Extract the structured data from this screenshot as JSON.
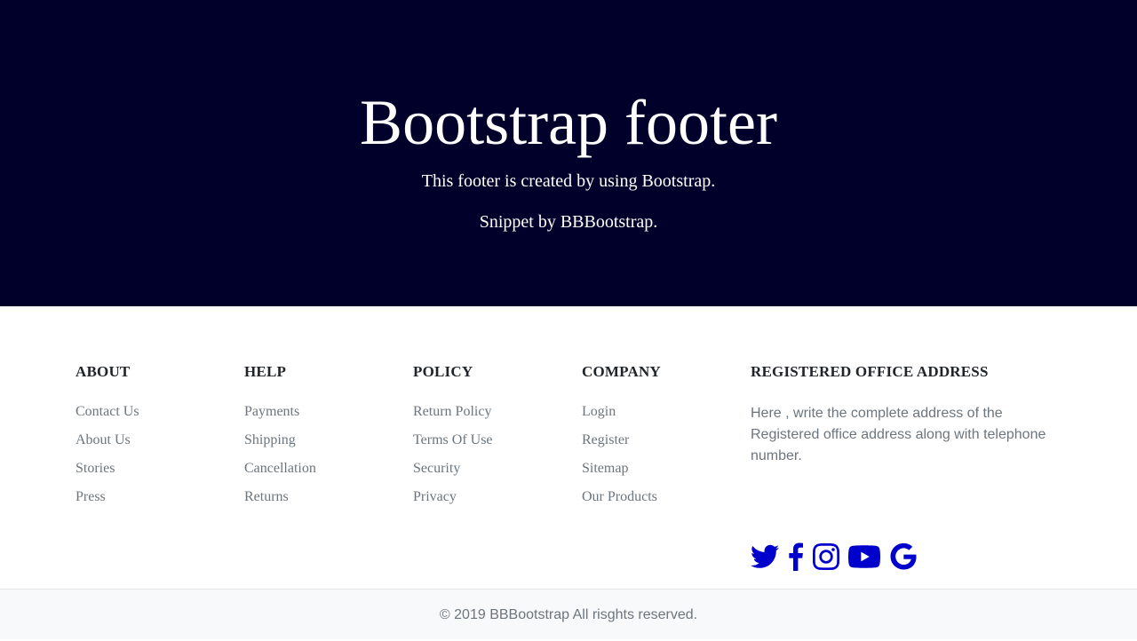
{
  "hero": {
    "title": "Bootstrap footer",
    "subtitle": "This footer is created by using Bootstrap.",
    "credit": "Snippet by BBBootstrap."
  },
  "columns": [
    {
      "heading": "ABOUT",
      "links": [
        "Contact Us",
        "About Us",
        "Stories",
        "Press"
      ]
    },
    {
      "heading": "HELP",
      "links": [
        "Payments",
        "Shipping",
        "Cancellation",
        "Returns"
      ]
    },
    {
      "heading": "POLICY",
      "links": [
        "Return Policy",
        "Terms Of Use",
        "Security",
        "Privacy"
      ]
    },
    {
      "heading": "COMPANY",
      "links": [
        "Login",
        "Register",
        "Sitemap",
        "Our Products"
      ]
    }
  ],
  "office": {
    "heading": "REGISTERED OFFICE ADDRESS",
    "address": "Here , write the complete address of the Registered office address along with telephone number."
  },
  "social": {
    "icons": [
      "twitter-icon",
      "facebook-icon",
      "instagram-icon",
      "youtube-icon",
      "google-icon"
    ],
    "color": "#0000cc"
  },
  "copyright": "© 2019 BBBootstrap All risghts reserved.",
  "colors": {
    "hero_bg": "#00002a",
    "link_gray": "#6c757d",
    "heading": "#212529",
    "copyright_bg": "#f8f9fa"
  }
}
